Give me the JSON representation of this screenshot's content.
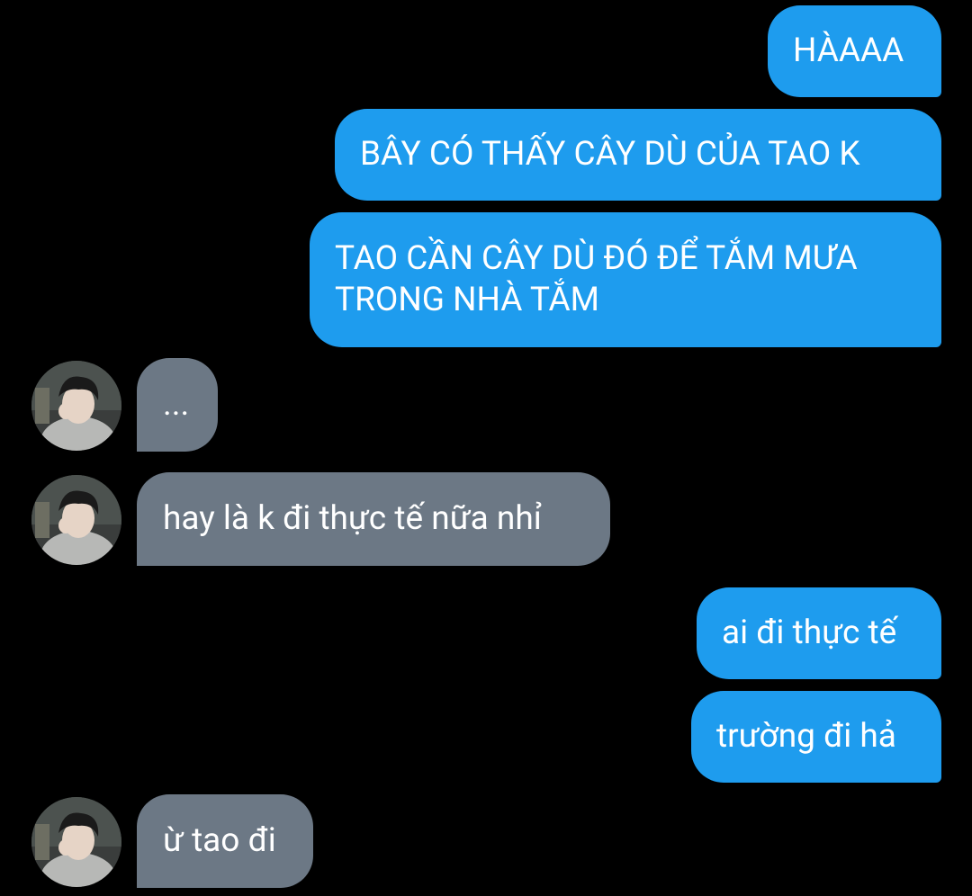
{
  "colors": {
    "background": "#000000",
    "outgoing_bubble": "#1e9cee",
    "incoming_bubble": "#6c7885",
    "text": "#ffffff"
  },
  "messages": {
    "m1": "HÀAAA",
    "m2": "BÂY CÓ THẤY CÂY DÙ CỦA TAO K",
    "m3_line1": "TAO CẦN CÂY DÙ ĐÓ ĐỂ TẮM MƯA",
    "m3_line2": "TRONG NHÀ TẮM",
    "m4": "...",
    "m5": "hay là k đi thực tế nữa nhỉ",
    "m6": "ai đi thực tế",
    "m7": "trường đi hả",
    "m8": "ừ tao đi"
  },
  "avatar": {
    "icon": "contact-avatar-photo"
  }
}
